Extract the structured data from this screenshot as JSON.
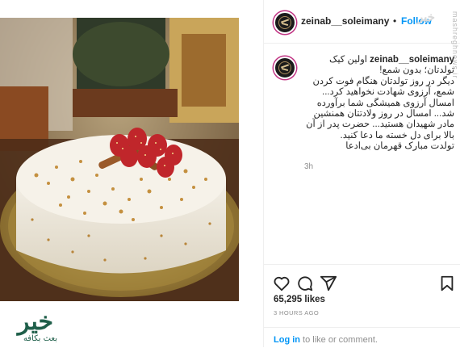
{
  "post": {
    "username": "zeinab__soleimany",
    "header_dot": "•",
    "follow_label": "Follow",
    "caption_lines": [
      "اولین کیک",
      "تولدتان؛ بدون شمع!",
      "دیگر در روز تولدتان هنگام فوت کردن",
      "شمع، آرزوی شهادت نخواهید کرد...",
      "امسال آرزوی همیشگی شما برآورده",
      "شد... امسال در روز ولادتتان همنشین",
      "مادر شهیدان هستید... حضرت پدر از آن",
      "بالا برای دل خسته ما دعا کنید.",
      "تولدت مبارک قهرمان بی‌ادعا"
    ],
    "time": "3h",
    "likes": "65,295 likes",
    "ago": "3 HOURS AGO",
    "login_link": "Log in",
    "login_rest": " to like or comment."
  },
  "watermark": {
    "top": "خبر",
    "side": "mashreghnews.ir"
  },
  "logo": {
    "main": "خیر",
    "sub": "بعث بکافه"
  },
  "icons": {
    "like": "heart-icon",
    "comment": "comment-icon",
    "share": "share-icon",
    "save": "bookmark-icon"
  },
  "colors": {
    "accent": "#0095f6",
    "text": "#262626",
    "muted": "#8e8e8e",
    "logo": "#1f5f4a"
  }
}
